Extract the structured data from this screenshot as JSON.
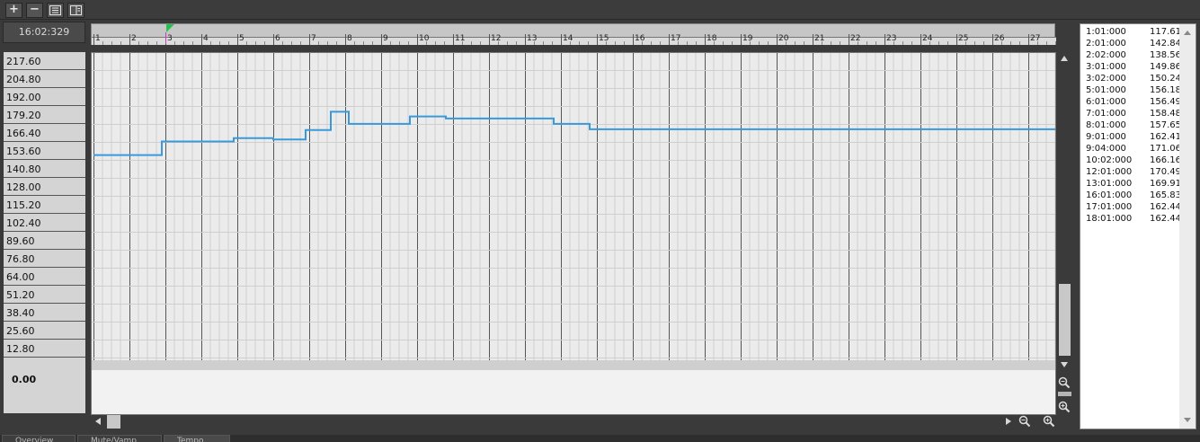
{
  "toolbar": {
    "buttons": [
      {
        "name": "add-button",
        "symbol": "+"
      },
      {
        "name": "remove-button",
        "symbol": "−"
      },
      {
        "name": "list-view-button",
        "icon": "list-icon"
      },
      {
        "name": "panel-view-button",
        "icon": "panel-icon"
      }
    ]
  },
  "time_display": "16:02:329",
  "ruler": {
    "bars": [
      "1",
      "2",
      "3",
      "4",
      "5",
      "6",
      "7",
      "8",
      "9",
      "10",
      "11",
      "12",
      "13",
      "14",
      "15",
      "16",
      "17",
      "18",
      "19",
      "20",
      "21",
      "22",
      "23",
      "24",
      "25",
      "26",
      "27"
    ],
    "playhead_bar": 3
  },
  "y_axis": {
    "labels": [
      "217.60",
      "204.80",
      "192.00",
      "179.20",
      "166.40",
      "153.60",
      "140.80",
      "128.00",
      "115.20",
      "102.40",
      "89.60",
      "76.80",
      "64.00",
      "51.20",
      "38.40",
      "25.60",
      "12.80",
      "0.00"
    ]
  },
  "chart_data": {
    "type": "line",
    "step": true,
    "x_unit": "bar",
    "ylim": [
      0,
      230.4
    ],
    "xlim": [
      1,
      27.8
    ],
    "series": [
      {
        "color": "#3a9ad9",
        "points": [
          {
            "x": 1.0,
            "y": 155.0
          },
          {
            "x": 2.9,
            "y": 155.0
          },
          {
            "x": 2.9,
            "y": 165.0
          },
          {
            "x": 4.9,
            "y": 165.0
          },
          {
            "x": 4.9,
            "y": 167.5
          },
          {
            "x": 6.0,
            "y": 167.5
          },
          {
            "x": 6.0,
            "y": 166.5
          },
          {
            "x": 6.9,
            "y": 166.5
          },
          {
            "x": 6.9,
            "y": 173.5
          },
          {
            "x": 7.6,
            "y": 173.5
          },
          {
            "x": 7.6,
            "y": 187.0
          },
          {
            "x": 8.1,
            "y": 187.0
          },
          {
            "x": 8.1,
            "y": 178.0
          },
          {
            "x": 9.8,
            "y": 178.0
          },
          {
            "x": 9.8,
            "y": 183.5
          },
          {
            "x": 10.8,
            "y": 183.5
          },
          {
            "x": 10.8,
            "y": 182.0
          },
          {
            "x": 13.8,
            "y": 182.0
          },
          {
            "x": 13.8,
            "y": 178.0
          },
          {
            "x": 14.8,
            "y": 178.0
          },
          {
            "x": 14.8,
            "y": 174.0
          },
          {
            "x": 27.8,
            "y": 174.0
          }
        ]
      }
    ]
  },
  "event_list": [
    {
      "time": "1:01:000",
      "value": "117.61"
    },
    {
      "time": "2:01:000",
      "value": "142.84"
    },
    {
      "time": "2:02:000",
      "value": "138.56"
    },
    {
      "time": "3:01:000",
      "value": "149.86"
    },
    {
      "time": "3:02:000",
      "value": "150.24"
    },
    {
      "time": "5:01:000",
      "value": "156.18"
    },
    {
      "time": "6:01:000",
      "value": "156.49"
    },
    {
      "time": "7:01:000",
      "value": "158.48"
    },
    {
      "time": "8:01:000",
      "value": "157.65"
    },
    {
      "time": "9:01:000",
      "value": "162.41"
    },
    {
      "time": "9:04:000",
      "value": "171.06"
    },
    {
      "time": "10:02:000",
      "value": "166.16"
    },
    {
      "time": "12:01:000",
      "value": "170.49"
    },
    {
      "time": "13:01:000",
      "value": "169.91"
    },
    {
      "time": "16:01:000",
      "value": "165.83"
    },
    {
      "time": "17:01:000",
      "value": "162.44"
    },
    {
      "time": "18:01:000",
      "value": "162.44"
    }
  ],
  "bottom_tabs": [
    {
      "label": "Overview"
    },
    {
      "label": "Mute/Vamp"
    },
    {
      "label": "Tempo"
    }
  ],
  "colors": {
    "line": "#3a9ad9",
    "playhead_marker": "#27c24c",
    "plot_bg": "#f0f0f0",
    "panel_bg": "#3a3a3a"
  }
}
